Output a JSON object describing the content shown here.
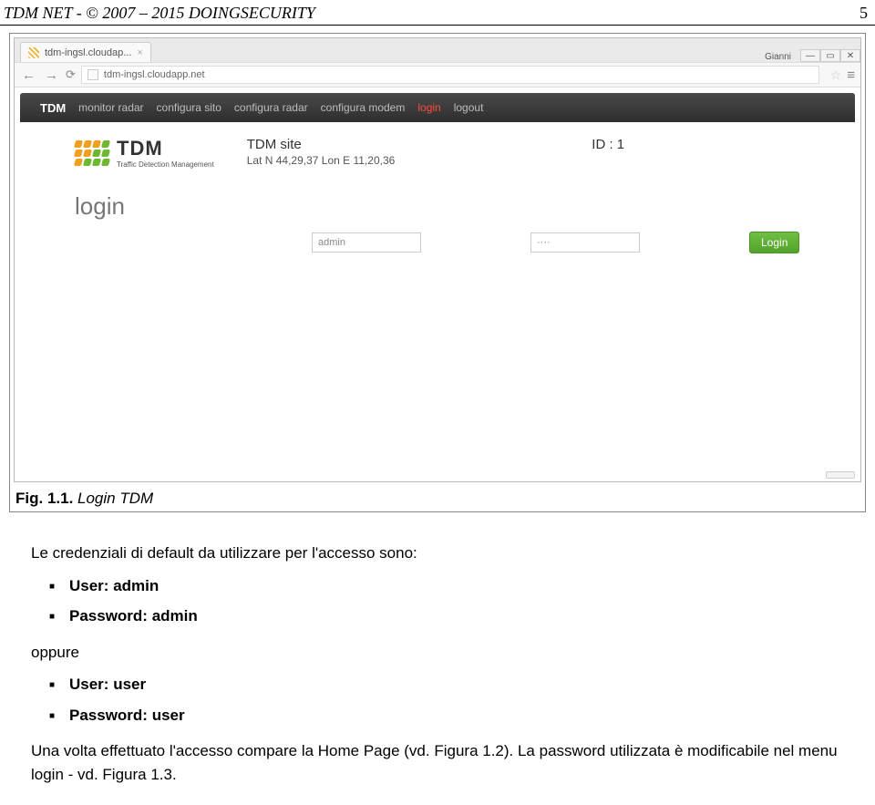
{
  "header": {
    "title": "TDM NET - © 2007 – 2015 DOINGSECURITY",
    "page_number": "5"
  },
  "browser": {
    "user_label": "Gianni",
    "win_min": "—",
    "win_max": "▭",
    "win_close": "✕",
    "tab_title": "tdm-ingsl.cloudap...",
    "tab_close": "×",
    "nav_back": "←",
    "nav_fwd": "→",
    "nav_reload": "⟳",
    "url": "tdm-ingsl.cloudapp.net",
    "star": "☆",
    "menu": "≡"
  },
  "sitenav": {
    "brand": "TDM",
    "items": [
      "monitor radar",
      "configura sito",
      "configura radar",
      "configura modem",
      "login",
      "logout"
    ],
    "active_index": 4
  },
  "siteheader": {
    "logo_big": "TDM",
    "logo_small": "Traffic Detection Management",
    "site_title": "TDM site",
    "site_coords": "Lat N 44,29,37 Lon E 11,20,36",
    "site_id_label": "ID : 1"
  },
  "login": {
    "heading": "login",
    "username_value": "admin",
    "password_value": "····",
    "button_label": "Login"
  },
  "caption": {
    "label": "Fig. 1.1.",
    "text": " Login TDM"
  },
  "doc": {
    "intro": "Le credenziali di default da utilizzare per l'accesso sono:",
    "cred1_user_label": "User: ",
    "cred1_user_value": "admin",
    "cred1_pass_label": "Password: ",
    "cred1_pass_value": "admin",
    "oppure": "oppure",
    "cred2_user_label": "User: ",
    "cred2_user_value": "user",
    "cred2_pass_label": "Password: ",
    "cred2_pass_value": "user",
    "outro": "Una volta effettuato l'accesso compare la Home Page (vd. Figura 1.2). La password utilizzata è modificabile nel menu login - vd. Figura 1.3."
  }
}
